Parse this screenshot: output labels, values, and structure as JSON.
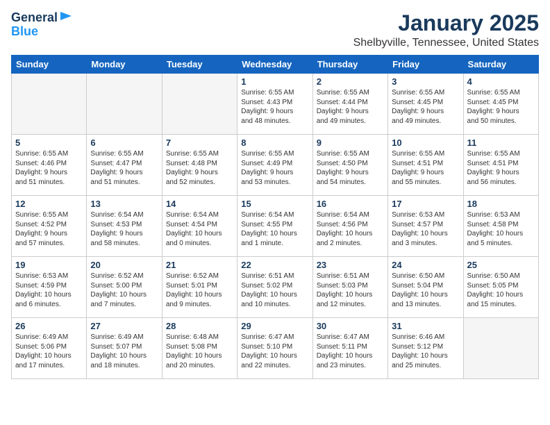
{
  "logo": {
    "line1": "General",
    "line2": "Blue"
  },
  "title": "January 2025",
  "subtitle": "Shelbyville, Tennessee, United States",
  "days_of_week": [
    "Sunday",
    "Monday",
    "Tuesday",
    "Wednesday",
    "Thursday",
    "Friday",
    "Saturday"
  ],
  "weeks": [
    [
      {
        "day": "",
        "info": ""
      },
      {
        "day": "",
        "info": ""
      },
      {
        "day": "",
        "info": ""
      },
      {
        "day": "1",
        "info": "Sunrise: 6:55 AM\nSunset: 4:43 PM\nDaylight: 9 hours\nand 48 minutes."
      },
      {
        "day": "2",
        "info": "Sunrise: 6:55 AM\nSunset: 4:44 PM\nDaylight: 9 hours\nand 49 minutes."
      },
      {
        "day": "3",
        "info": "Sunrise: 6:55 AM\nSunset: 4:45 PM\nDaylight: 9 hours\nand 49 minutes."
      },
      {
        "day": "4",
        "info": "Sunrise: 6:55 AM\nSunset: 4:45 PM\nDaylight: 9 hours\nand 50 minutes."
      }
    ],
    [
      {
        "day": "5",
        "info": "Sunrise: 6:55 AM\nSunset: 4:46 PM\nDaylight: 9 hours\nand 51 minutes."
      },
      {
        "day": "6",
        "info": "Sunrise: 6:55 AM\nSunset: 4:47 PM\nDaylight: 9 hours\nand 51 minutes."
      },
      {
        "day": "7",
        "info": "Sunrise: 6:55 AM\nSunset: 4:48 PM\nDaylight: 9 hours\nand 52 minutes."
      },
      {
        "day": "8",
        "info": "Sunrise: 6:55 AM\nSunset: 4:49 PM\nDaylight: 9 hours\nand 53 minutes."
      },
      {
        "day": "9",
        "info": "Sunrise: 6:55 AM\nSunset: 4:50 PM\nDaylight: 9 hours\nand 54 minutes."
      },
      {
        "day": "10",
        "info": "Sunrise: 6:55 AM\nSunset: 4:51 PM\nDaylight: 9 hours\nand 55 minutes."
      },
      {
        "day": "11",
        "info": "Sunrise: 6:55 AM\nSunset: 4:51 PM\nDaylight: 9 hours\nand 56 minutes."
      }
    ],
    [
      {
        "day": "12",
        "info": "Sunrise: 6:55 AM\nSunset: 4:52 PM\nDaylight: 9 hours\nand 57 minutes."
      },
      {
        "day": "13",
        "info": "Sunrise: 6:54 AM\nSunset: 4:53 PM\nDaylight: 9 hours\nand 58 minutes."
      },
      {
        "day": "14",
        "info": "Sunrise: 6:54 AM\nSunset: 4:54 PM\nDaylight: 10 hours\nand 0 minutes."
      },
      {
        "day": "15",
        "info": "Sunrise: 6:54 AM\nSunset: 4:55 PM\nDaylight: 10 hours\nand 1 minute."
      },
      {
        "day": "16",
        "info": "Sunrise: 6:54 AM\nSunset: 4:56 PM\nDaylight: 10 hours\nand 2 minutes."
      },
      {
        "day": "17",
        "info": "Sunrise: 6:53 AM\nSunset: 4:57 PM\nDaylight: 10 hours\nand 3 minutes."
      },
      {
        "day": "18",
        "info": "Sunrise: 6:53 AM\nSunset: 4:58 PM\nDaylight: 10 hours\nand 5 minutes."
      }
    ],
    [
      {
        "day": "19",
        "info": "Sunrise: 6:53 AM\nSunset: 4:59 PM\nDaylight: 10 hours\nand 6 minutes."
      },
      {
        "day": "20",
        "info": "Sunrise: 6:52 AM\nSunset: 5:00 PM\nDaylight: 10 hours\nand 7 minutes."
      },
      {
        "day": "21",
        "info": "Sunrise: 6:52 AM\nSunset: 5:01 PM\nDaylight: 10 hours\nand 9 minutes."
      },
      {
        "day": "22",
        "info": "Sunrise: 6:51 AM\nSunset: 5:02 PM\nDaylight: 10 hours\nand 10 minutes."
      },
      {
        "day": "23",
        "info": "Sunrise: 6:51 AM\nSunset: 5:03 PM\nDaylight: 10 hours\nand 12 minutes."
      },
      {
        "day": "24",
        "info": "Sunrise: 6:50 AM\nSunset: 5:04 PM\nDaylight: 10 hours\nand 13 minutes."
      },
      {
        "day": "25",
        "info": "Sunrise: 6:50 AM\nSunset: 5:05 PM\nDaylight: 10 hours\nand 15 minutes."
      }
    ],
    [
      {
        "day": "26",
        "info": "Sunrise: 6:49 AM\nSunset: 5:06 PM\nDaylight: 10 hours\nand 17 minutes."
      },
      {
        "day": "27",
        "info": "Sunrise: 6:49 AM\nSunset: 5:07 PM\nDaylight: 10 hours\nand 18 minutes."
      },
      {
        "day": "28",
        "info": "Sunrise: 6:48 AM\nSunset: 5:08 PM\nDaylight: 10 hours\nand 20 minutes."
      },
      {
        "day": "29",
        "info": "Sunrise: 6:47 AM\nSunset: 5:10 PM\nDaylight: 10 hours\nand 22 minutes."
      },
      {
        "day": "30",
        "info": "Sunrise: 6:47 AM\nSunset: 5:11 PM\nDaylight: 10 hours\nand 23 minutes."
      },
      {
        "day": "31",
        "info": "Sunrise: 6:46 AM\nSunset: 5:12 PM\nDaylight: 10 hours\nand 25 minutes."
      },
      {
        "day": "",
        "info": ""
      }
    ]
  ]
}
